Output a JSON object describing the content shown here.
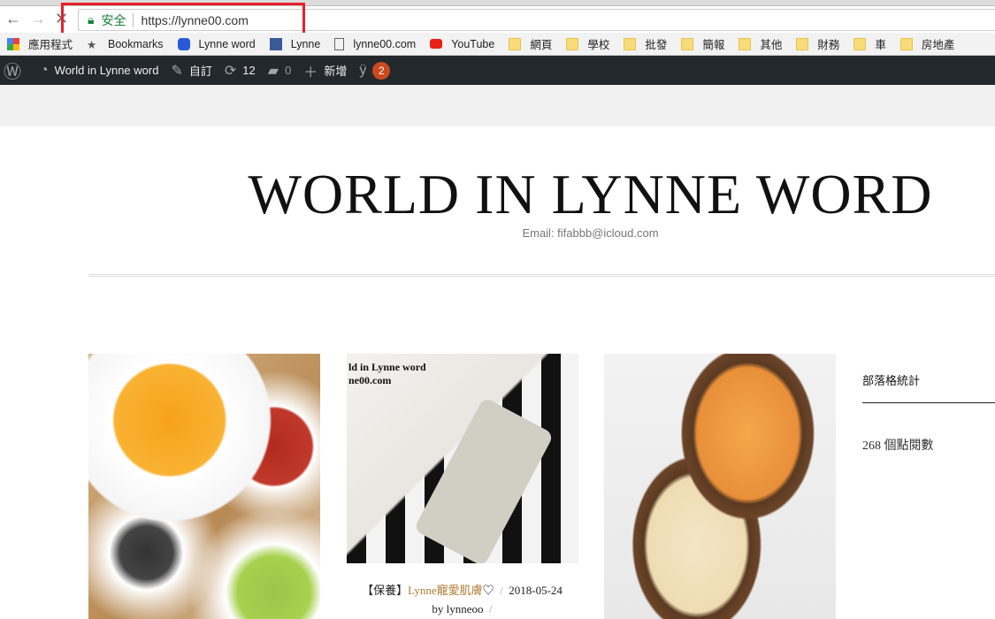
{
  "browser": {
    "secure_label": "安全",
    "url": "https://lynne00.com",
    "bookmarks": [
      {
        "label": "應用程式",
        "icon": "apps-grid-icon"
      },
      {
        "label": "Bookmarks",
        "icon": "star-icon"
      },
      {
        "label": "Lynne word",
        "icon": "chat-bubble-icon"
      },
      {
        "label": "Lynne",
        "icon": "facebook-icon"
      },
      {
        "label": "lynne00.com",
        "icon": "page-icon"
      },
      {
        "label": "YouTube",
        "icon": "youtube-icon"
      },
      {
        "label": "網頁",
        "icon": "folder-icon"
      },
      {
        "label": "學校",
        "icon": "folder-icon"
      },
      {
        "label": "批發",
        "icon": "folder-icon"
      },
      {
        "label": "簡報",
        "icon": "folder-icon"
      },
      {
        "label": "其他",
        "icon": "folder-icon"
      },
      {
        "label": "財務",
        "icon": "folder-icon"
      },
      {
        "label": "車",
        "icon": "folder-icon"
      },
      {
        "label": "房地產",
        "icon": "folder-icon"
      }
    ]
  },
  "adminbar": {
    "site_name": "World in Lynne word",
    "customize": "自訂",
    "updates": "12",
    "comments": "0",
    "new": "新增",
    "yoast_badge": "2"
  },
  "site": {
    "title": "WORLD IN LYNNE WORD",
    "email": "Email: fifabbb@icloud.com"
  },
  "posts": [
    {
      "overlay_line1": "ld in Lynne word",
      "overlay_line2": "ne00.com",
      "category": "【保養】",
      "title": "Lynne寵愛肌膚",
      "heart": "♡",
      "sep": "/",
      "date": "2018-05-24",
      "byline": "by lynneoo",
      "sep2": "/"
    }
  ],
  "sidebar": {
    "title": "部落格統計",
    "stat": "268 個點閱數"
  }
}
